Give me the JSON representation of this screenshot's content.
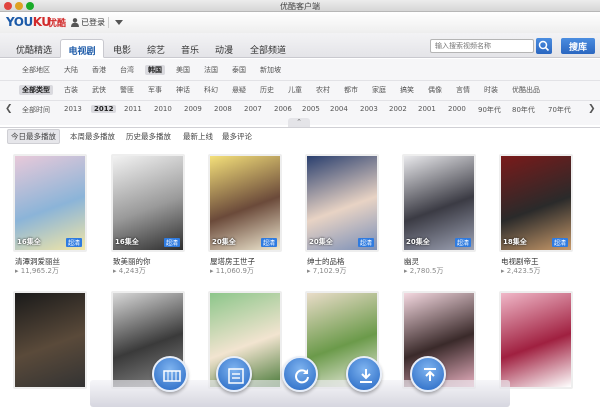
{
  "window": {
    "title": "优酷客户端"
  },
  "brand": {
    "logo_a": "YOU",
    "logo_b": "KU",
    "logo_cn": "优酷",
    "login": "已登录"
  },
  "nav": {
    "tabs": [
      "优酷精选",
      "电视剧",
      "电影",
      "综艺",
      "音乐",
      "动漫",
      "全部频道"
    ],
    "active": "电视剧",
    "search_placeholder": "输入搜索视频名称",
    "search_button": "搜库"
  },
  "filters": {
    "region": [
      "全部地区",
      "大陆",
      "香港",
      "台湾",
      "韩国",
      "美国",
      "法国",
      "泰国",
      "新加坡"
    ],
    "region_selected": "韩国",
    "genre": [
      "全部类型",
      "古装",
      "武侠",
      "警匪",
      "军事",
      "神话",
      "科幻",
      "悬疑",
      "历史",
      "儿童",
      "农村",
      "都市",
      "家庭",
      "搞笑",
      "偶像",
      "言情",
      "时装",
      "优酷出品"
    ],
    "year": [
      "全部时间",
      "2013",
      "2012",
      "2011",
      "2010",
      "2009",
      "2008",
      "2007",
      "2006",
      "2005",
      "2004",
      "2003",
      "2002",
      "2001",
      "2000",
      "90年代",
      "80年代",
      "70年代"
    ],
    "year_selected": "2012"
  },
  "sort": {
    "options": [
      "今日最多播放",
      "本周最多播放",
      "历史最多播放",
      "最新上线",
      "最多评论"
    ],
    "active": "今日最多播放"
  },
  "items": [
    {
      "title": "清潭洞爱丽丝",
      "plays": "11,965.2万",
      "episodes": "16集全",
      "hd": "超清",
      "colors": [
        "#e8c9d9",
        "#8bb4d8",
        "#f2e6a6"
      ]
    },
    {
      "title": "致美丽的你",
      "plays": "4,243万",
      "episodes": "16集全",
      "hd": "超清",
      "colors": [
        "#f2f2f2",
        "#9a9a9a",
        "#2d2d2d"
      ]
    },
    {
      "title": "屋塔房王世子",
      "plays": "11,060.9万",
      "episodes": "20集全",
      "hd": "超清",
      "colors": [
        "#f4e07a",
        "#6b4a3a",
        "#f0e9d2"
      ]
    },
    {
      "title": "绅士的品格",
      "plays": "7,102.9万",
      "episodes": "20集全",
      "hd": "超清",
      "colors": [
        "#2a3f6e",
        "#e8d3c4",
        "#7a8fb8"
      ]
    },
    {
      "title": "幽灵",
      "plays": "2,780.5万",
      "episodes": "20集全",
      "hd": "超清",
      "colors": [
        "#e9e9ec",
        "#3b3b44",
        "#9ea3b5"
      ]
    },
    {
      "title": "电视剧帝王",
      "plays": "2,423.5万",
      "episodes": "18集全",
      "hd": "超清",
      "colors": [
        "#7a1a1a",
        "#2a2a2a",
        "#c99a6a"
      ]
    },
    {
      "colors": [
        "#1a1a1a",
        "#5a4a3a",
        "#333"
      ]
    },
    {
      "colors": [
        "#d8d8d8",
        "#3a3a3a",
        "#8a8a8a"
      ]
    },
    {
      "colors": [
        "#8cc68a",
        "#f2e4d0",
        "#4a7a3a"
      ]
    },
    {
      "colors": [
        "#e9dcc8",
        "#6b9a4a",
        "#f2f0e8"
      ]
    },
    {
      "colors": [
        "#f4d8e0",
        "#3a2a2a",
        "#e8b0c0"
      ]
    },
    {
      "colors": [
        "#f0b8c8",
        "#a02040",
        "#ffffff"
      ]
    }
  ],
  "dock": [
    "film-list",
    "playlist",
    "refresh",
    "download",
    "upload"
  ]
}
